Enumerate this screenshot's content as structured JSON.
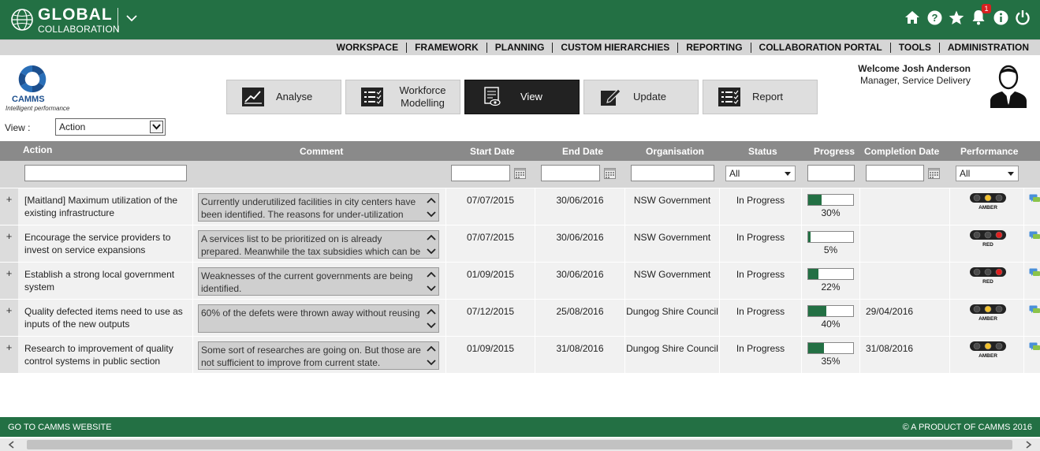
{
  "header": {
    "logo_big": "GLOBAL",
    "logo_small": "COLLABORATION",
    "notification_count": "1",
    "icons": [
      "home-icon",
      "help-icon",
      "star-icon",
      "bell-icon",
      "info-icon",
      "power-icon"
    ]
  },
  "menu": [
    "WORKSPACE",
    "FRAMEWORK",
    "PLANNING",
    "CUSTOM HIERARCHIES",
    "REPORTING",
    "COLLABORATION PORTAL",
    "TOOLS",
    "ADMINISTRATION"
  ],
  "brand": {
    "name": "CAMMS",
    "tagline": "Intelligent performance"
  },
  "modes": [
    "Analyse",
    "Workforce Modelling",
    "View",
    "Update",
    "Report"
  ],
  "active_mode": "View",
  "user": {
    "welcome": "Welcome Josh Anderson",
    "role": "Manager, Service Delivery"
  },
  "view": {
    "label": "View :",
    "selected": "Action"
  },
  "table": {
    "columns": [
      "Action",
      "Comment",
      "Start Date",
      "End Date",
      "Organisation",
      "Status",
      "Progress",
      "Completion Date",
      "Performance"
    ],
    "filters": {
      "status": "All",
      "performance": "All"
    },
    "rows": [
      {
        "action": "[Maitland] Maximum utilization of the existing infrastructure",
        "comment": "Currently underutilized facilities in city centers have been identified. The reasons for under-utilization",
        "start": "07/07/2015",
        "end": "30/06/2016",
        "org": "NSW Government",
        "status": "In Progress",
        "progress": 30,
        "progress_label": "30%",
        "completion": "",
        "performance": "AMBER"
      },
      {
        "action": "Encourage the service providers to invest on service expansions",
        "comment": "A services list to be prioritized on is already prepared. Meanwhile the tax subsidies which can be",
        "start": "07/07/2015",
        "end": "30/06/2016",
        "org": "NSW Government",
        "status": "In Progress",
        "progress": 5,
        "progress_label": "5%",
        "completion": "",
        "performance": "RED"
      },
      {
        "action": "Establish a strong local government system",
        "comment": "Weaknesses of the current governments are being identified.",
        "start": "01/09/2015",
        "end": "30/06/2016",
        "org": "NSW Government",
        "status": "In Progress",
        "progress": 22,
        "progress_label": "22%",
        "completion": "",
        "performance": "RED"
      },
      {
        "action": "Quality defected items need to use as inputs of the new outputs",
        "comment": "60% of the defets were thrown away without reusing",
        "start": "07/12/2015",
        "end": "25/08/2016",
        "org": "Dungog Shire Council",
        "status": "In Progress",
        "progress": 40,
        "progress_label": "40%",
        "completion": "29/04/2016",
        "performance": "AMBER"
      },
      {
        "action": "Research to improvement of quality control systems in public section",
        "comment": "Some sort of researches are going on. But those are not sufficient to improve from current state.",
        "start": "01/09/2015",
        "end": "31/08/2016",
        "org": "Dungog Shire Council",
        "status": "In Progress",
        "progress": 35,
        "progress_label": "35%",
        "completion": "31/08/2016",
        "performance": "AMBER"
      }
    ]
  },
  "footer": {
    "left": "GO TO CAMMS WEBSITE",
    "right": "© A PRODUCT OF CAMMS 2016"
  },
  "colors": {
    "brand_green": "#237044",
    "header_gray": "#8a8a8a",
    "red": "#e02020",
    "amber": "#f2c12e"
  }
}
